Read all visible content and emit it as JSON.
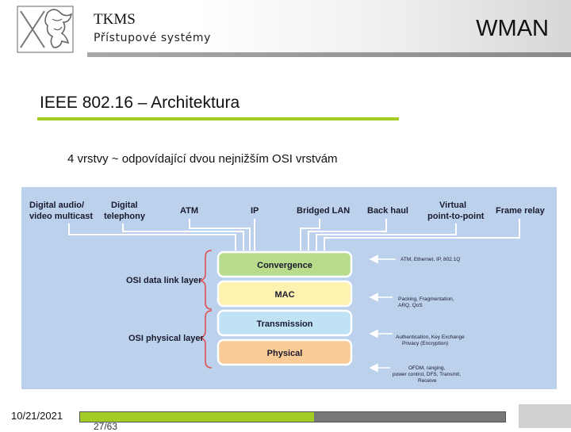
{
  "header": {
    "org": "TKMS",
    "subtitle": "Přístupové systémy",
    "topic": "WMAN"
  },
  "slide": {
    "title": "IEEE 802.16 – Architektura",
    "lead": "4 vrstvy  ~  odpovídající dvou nejnižším OSI vrstvám"
  },
  "diagram": {
    "services": [
      "Digital audio/",
      "video multicast",
      "Digital",
      "telephony",
      "ATM",
      "IP",
      "Bridged LAN",
      "Back haul",
      "Virtual",
      "point-to-point",
      "Frame relay"
    ],
    "osi_labels": [
      "OSI data link layer",
      "OSI physical layer"
    ],
    "layers": [
      {
        "name": "Convergence",
        "color": "#b8dc8c"
      },
      {
        "name": "MAC",
        "color": "#fff1b0"
      },
      {
        "name": "Transmission",
        "color": "#bfe3f5"
      },
      {
        "name": "Physical",
        "color": "#f9cc97"
      }
    ],
    "notes": [
      [
        "ATM, Ethernet, IP, 802.1Q"
      ],
      [
        "Packing, Fragmentation,",
        "ARQ, QoS"
      ],
      [
        "Authentication, Key Exchange",
        "Privacy (Encryption)"
      ],
      [
        "OFDM, ranging,",
        "power control, DFS, Transmit,",
        "Receive"
      ]
    ],
    "background": "#bcd2ec",
    "brace_color": "#e05050"
  },
  "footer": {
    "date": "10/21/2021",
    "page": "27/63",
    "progress": 0.55,
    "progress_color": "#a4cc27"
  }
}
